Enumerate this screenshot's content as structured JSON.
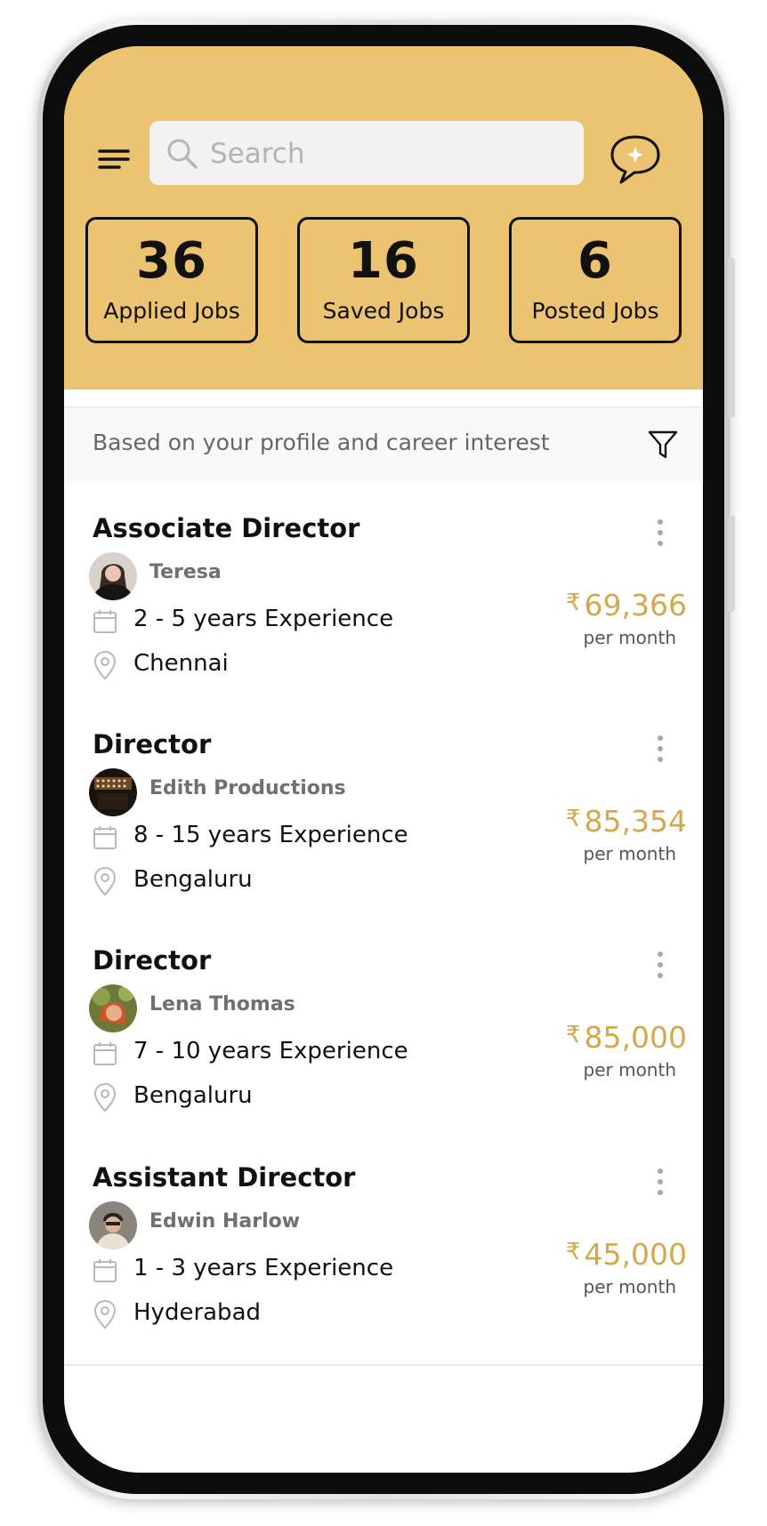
{
  "header": {
    "search_placeholder": "Search",
    "background_color": "#ebc371"
  },
  "stats": [
    {
      "value": "36",
      "label": "Applied Jobs"
    },
    {
      "value": "16",
      "label": "Saved Jobs"
    },
    {
      "value": "6",
      "label": "Posted Jobs"
    }
  ],
  "recommendation": {
    "text": "Based on your profile and career interest"
  },
  "jobs": [
    {
      "title": "Associate Director",
      "company": "Teresa",
      "experience": "2 - 5 years Experience",
      "location": "Chennai",
      "currency": "₹",
      "salary": "69,366",
      "period": "per month"
    },
    {
      "title": "Director",
      "company": "Edith Productions",
      "experience": "8 - 15 years Experience",
      "location": "Bengaluru",
      "currency": "₹",
      "salary": "85,354",
      "period": "per month"
    },
    {
      "title": "Director",
      "company": "Lena Thomas",
      "experience": "7 - 10 years Experience",
      "location": "Bengaluru",
      "currency": "₹",
      "salary": "85,000",
      "period": "per month"
    },
    {
      "title": "Assistant Director",
      "company": "Edwin Harlow",
      "experience": "1 - 3 years Experience",
      "location": "Hyderabad",
      "currency": "₹",
      "salary": "45,000",
      "period": "per month"
    }
  ],
  "colors": {
    "accent": "#ebc371",
    "salary": "#d4a84e"
  },
  "icons": [
    "menu-icon",
    "search-icon",
    "chat-sparkle-icon",
    "filter-icon",
    "more-vertical-icon",
    "calendar-icon",
    "location-pin-icon"
  ]
}
